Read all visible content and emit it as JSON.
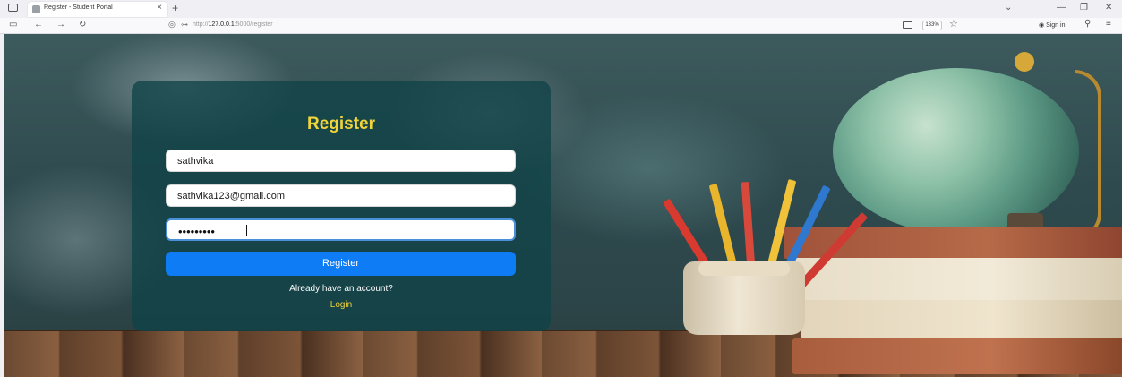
{
  "browser": {
    "tab_title": "Register - Student Portal",
    "tab_close": "×",
    "new_tab": "+",
    "url_scheme": "http://",
    "url_host": "127.0.0.1",
    "url_path": ":5000/register",
    "zoom": "133%",
    "signin_label": "Sign in"
  },
  "form": {
    "title": "Register",
    "username_value": "sathvika",
    "email_value": "sathvika123@gmail.com",
    "password_mask": "•••••••••",
    "submit_label": "Register",
    "prompt_text": "Already have an account?",
    "login_link": "Login"
  },
  "colors": {
    "accent_yellow": "#f0d43a",
    "button_blue": "#0d7cf5",
    "card_bg": "#104248"
  },
  "icons": {
    "back": "arrow-left-icon",
    "forward": "arrow-right-icon",
    "reload": "reload-icon",
    "menu": "hamburger-menu-icon"
  }
}
